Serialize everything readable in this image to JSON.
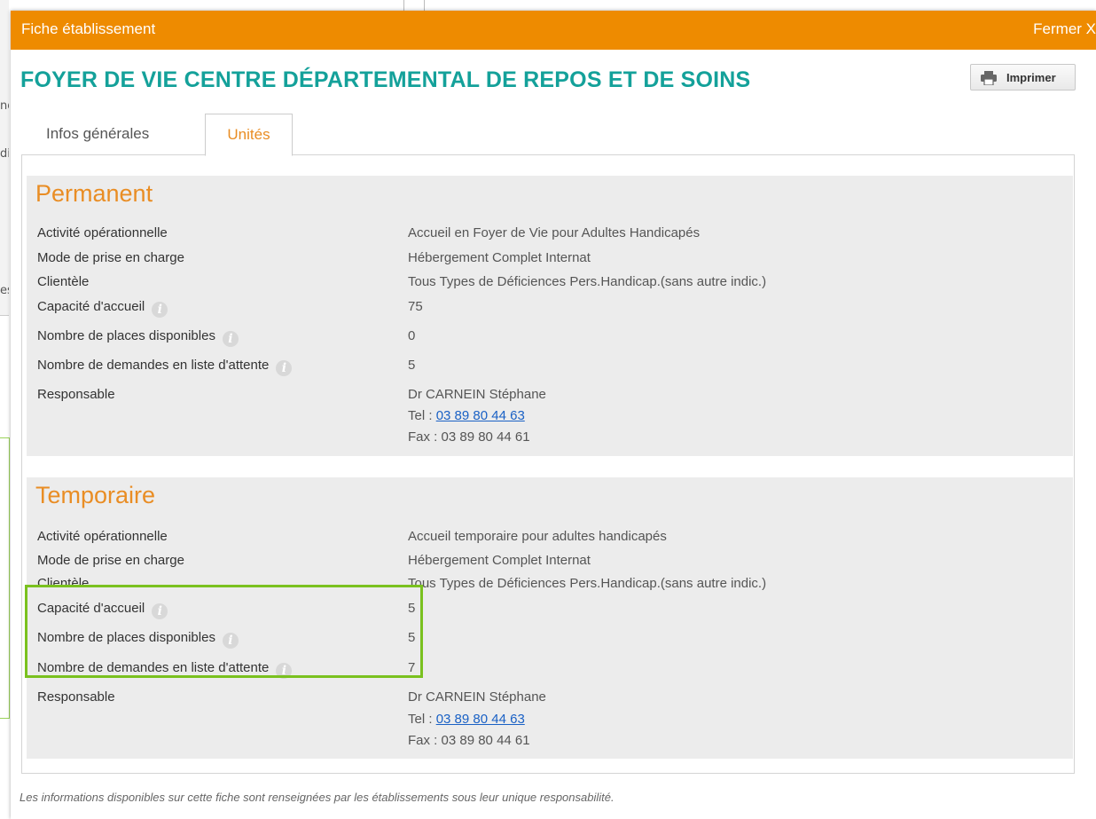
{
  "background": {
    "fragments": [
      "nd",
      "di",
      "es"
    ]
  },
  "modal": {
    "title": "Fiche établissement",
    "close_label": "Fermer X",
    "heading": "FOYER DE VIE CENTRE DÉPARTEMENTAL DE REPOS ET DE SOINS",
    "print_label": "Imprimer",
    "tabs": [
      {
        "label": "Infos générales",
        "active": false
      },
      {
        "label": "Unités",
        "active": true
      }
    ],
    "footer_note": "Les informations disponibles sur cette fiche sont renseignées par les établissements sous leur unique responsabilité."
  },
  "sections": [
    {
      "title": "Permanent",
      "activite": {
        "label": "Activité opérationnelle",
        "value": "Accueil en Foyer de Vie pour Adultes Handicapés"
      },
      "mode": {
        "label": "Mode de prise en charge",
        "value": "Hébergement Complet Internat"
      },
      "clientele": {
        "label": "Clientèle",
        "value": "Tous Types de Déficiences Pers.Handicap.(sans autre indic.)"
      },
      "capacite": {
        "label": "Capacité d'accueil",
        "value": "75"
      },
      "places": {
        "label": "Nombre de places disponibles",
        "value": "0"
      },
      "demandes": {
        "label": "Nombre de demandes en liste d'attente",
        "value": "5"
      },
      "responsable": {
        "label": "Responsable",
        "name": "Dr CARNEIN Stéphane",
        "tel_prefix": "Tel :",
        "tel": "03 89 80 44 63",
        "fax": "Fax : 03 89 80 44 61"
      }
    },
    {
      "title": "Temporaire",
      "activite": {
        "label": "Activité opérationnelle",
        "value": "Accueil temporaire pour adultes handicapés"
      },
      "mode": {
        "label": "Mode de prise en charge",
        "value": "Hébergement Complet Internat"
      },
      "clientele": {
        "label": "Clientèle",
        "value": "Tous Types de Déficiences Pers.Handicap.(sans autre indic.)"
      },
      "capacite": {
        "label": "Capacité d'accueil",
        "value": "5"
      },
      "places": {
        "label": "Nombre de places disponibles",
        "value": "5"
      },
      "demandes": {
        "label": "Nombre de demandes en liste d'attente",
        "value": "7"
      },
      "responsable": {
        "label": "Responsable",
        "name": "Dr CARNEIN Stéphane",
        "tel_prefix": "Tel :",
        "tel": "03 89 80 44 63",
        "fax": "Fax : 03 89 80 44 61"
      }
    }
  ],
  "colors": {
    "titlebar": "#ee8b00",
    "heading": "#14a19a",
    "section_title": "#e98d24",
    "highlight": "#7ac11f",
    "link": "#1a61c5"
  }
}
